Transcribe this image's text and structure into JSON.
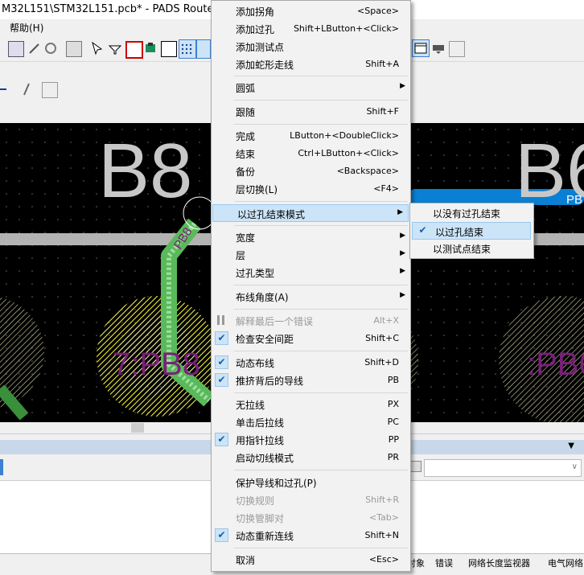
{
  "window": {
    "title": "M32L151\\STM32L151.pcb* - PADS Router"
  },
  "menubar": {
    "help": "帮助(H)"
  },
  "canvas": {
    "big_labels": [
      "B8",
      "B6"
    ],
    "pad_label_left": "7:PB8",
    "pad_label_right": ":PB6",
    "trace_label": "PB8",
    "net_label_right": "PB"
  },
  "context_menu": {
    "items": [
      {
        "label": "添加拐角",
        "shortcut": "<Space>"
      },
      {
        "label": "添加过孔",
        "shortcut": "Shift+LButton+<Click>"
      },
      {
        "label": "添加测试点",
        "shortcut": ""
      },
      {
        "label": "添加蛇形走线",
        "shortcut": "Shift+A"
      },
      {
        "label": "圆弧",
        "shortcut": ""
      },
      {
        "label": "跟随",
        "shortcut": "Shift+F"
      },
      {
        "label": "完成",
        "shortcut": "LButton+<DoubleClick>"
      },
      {
        "label": "结束",
        "shortcut": "Ctrl+LButton+<Click>"
      },
      {
        "label": "备份",
        "shortcut": "<Backspace>"
      },
      {
        "label": "层切换(L)",
        "shortcut": "<F4>"
      },
      {
        "label": "以过孔结束模式",
        "shortcut": ""
      },
      {
        "label": "宽度",
        "shortcut": ""
      },
      {
        "label": "层",
        "shortcut": ""
      },
      {
        "label": "过孔类型",
        "shortcut": ""
      },
      {
        "label": "布线角度(A)",
        "shortcut": ""
      },
      {
        "label": "解释最后一个错误",
        "shortcut": "Alt+X"
      },
      {
        "label": "检查安全间距",
        "shortcut": "Shift+C"
      },
      {
        "label": "动态布线",
        "shortcut": "Shift+D"
      },
      {
        "label": "推挤背后的导线",
        "shortcut": "PB"
      },
      {
        "label": "无拉线",
        "shortcut": "PX"
      },
      {
        "label": "单击后拉线",
        "shortcut": "PC"
      },
      {
        "label": "用指针拉线",
        "shortcut": "PP"
      },
      {
        "label": "启动切线模式",
        "shortcut": "PR"
      },
      {
        "label": "保护导线和过孔(P)",
        "shortcut": ""
      },
      {
        "label": "切换规则",
        "shortcut": "Shift+R"
      },
      {
        "label": "切换管脚对",
        "shortcut": "<Tab>"
      },
      {
        "label": "动态重新连线",
        "shortcut": "Shift+N"
      },
      {
        "label": "取消",
        "shortcut": "<Esc>"
      }
    ]
  },
  "submenu": {
    "items": [
      {
        "label": "以没有过孔结束"
      },
      {
        "label": "以过孔结束"
      },
      {
        "label": "以测试点结束"
      }
    ]
  },
  "bottom_tabs": [
    "对象",
    "错误",
    "网络长度监视器",
    "电气网络"
  ]
}
